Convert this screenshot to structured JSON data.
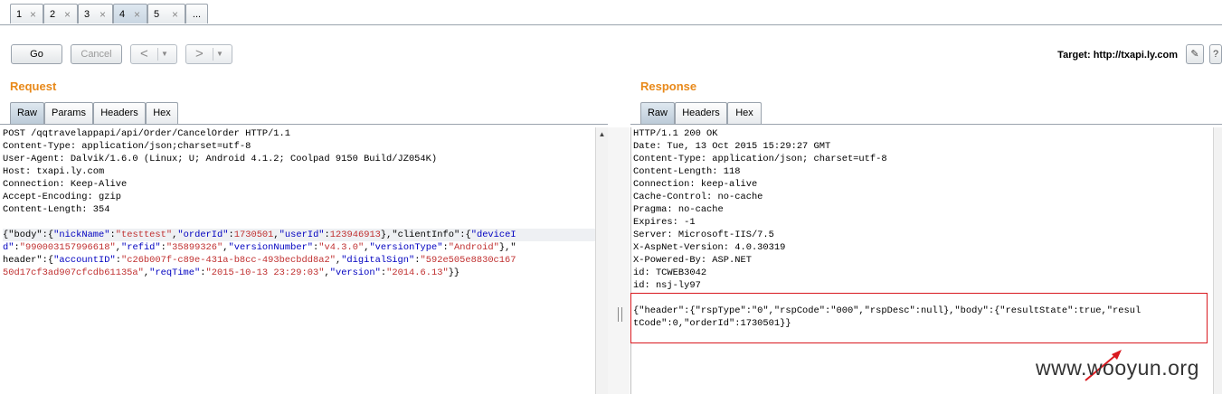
{
  "tabs": [
    {
      "label": "1",
      "close": "×"
    },
    {
      "label": "2",
      "close": "×"
    },
    {
      "label": "3",
      "close": "×"
    },
    {
      "label": "4",
      "close": "×",
      "active": true
    },
    {
      "label": "5",
      "close": "×"
    },
    {
      "label": "..."
    }
  ],
  "toolbar": {
    "go": "Go",
    "cancel": "Cancel",
    "back_arrow": "<",
    "forward_arrow": ">",
    "dropdown": "▼",
    "target_label": "Target: http://txapi.ly.com",
    "edit_icon": "✎",
    "help_icon": "?"
  },
  "request": {
    "title": "Request",
    "tabs": [
      "Raw",
      "Params",
      "Headers",
      "Hex"
    ],
    "headers": [
      "POST /qqtravelappapi/api/Order/CancelOrder HTTP/1.1",
      "Content-Type: application/json;charset=utf-8",
      "User-Agent: Dalvik/1.6.0 (Linux; U; Android 4.1.2; Coolpad 9150 Build/JZ054K)",
      "Host: txapi.ly.com",
      "Connection: Keep-Alive",
      "Accept-Encoding: gzip",
      "Content-Length: 354"
    ],
    "body": {
      "body_key": "\"body\"",
      "nickName_key": "\"nickName\"",
      "nickName_val": "\"testtest\"",
      "orderId_key": "\"orderId\"",
      "orderId_val": "1730501",
      "userId_key": "\"userId\"",
      "userId_val": "123946913",
      "clientInfo_key": "\"clientInfo\"",
      "deviceId_key_a": "\"deviceI",
      "deviceId_key_b": "d\"",
      "deviceId_val": "\"990003157996618\"",
      "refid_key": "\"refid\"",
      "refid_val": "\"35899326\"",
      "versionNumber_key": "\"versionNumber\"",
      "versionNumber_val": "\"v4.3.0\"",
      "versionType_key": "\"versionType\"",
      "versionType_val": "\"Android\"",
      "header_key": "header\"",
      "accountID_key": "\"accountID\"",
      "accountID_val": "\"c26b007f-c89e-431a-b8cc-493becbdd8a2\"",
      "digitalSign_key": "\"digitalSign\"",
      "digitalSign_val_a": "\"592e505e8830c167",
      "digitalSign_val_b": "50d17cf3ad907cfcdb61135a\"",
      "reqTime_key": "\"reqTime\"",
      "reqTime_val": "\"2015-10-13 23:29:03\"",
      "version_key": "\"version\"",
      "version_val": "\"2014.6.13\""
    }
  },
  "response": {
    "title": "Response",
    "tabs": [
      "Raw",
      "Headers",
      "Hex"
    ],
    "headers": [
      "HTTP/1.1 200 OK",
      "Date: Tue, 13 Oct 2015 15:29:27 GMT",
      "Content-Type: application/json; charset=utf-8",
      "Content-Length: 118",
      "Connection: keep-alive",
      "Cache-Control: no-cache",
      "Pragma: no-cache",
      "Expires: -1",
      "Server: Microsoft-IIS/7.5",
      "X-AspNet-Version: 4.0.30319",
      "X-Powered-By: ASP.NET",
      "id: TCWEB3042",
      "id: nsj-ly97"
    ],
    "body_lines": [
      "{\"header\":{\"rspType\":\"0\",\"rspCode\":\"000\",\"rspDesc\":null},\"body\":{\"resultState\":true,\"resul",
      "tCode\":0,\"orderId\":1730501}}"
    ]
  },
  "watermark": "www.wooyun.org",
  "colors": {
    "section_title": "#e8891a",
    "json_key": "#0000c0",
    "json_value": "#c03030",
    "highlight_border": "#d9191f"
  }
}
